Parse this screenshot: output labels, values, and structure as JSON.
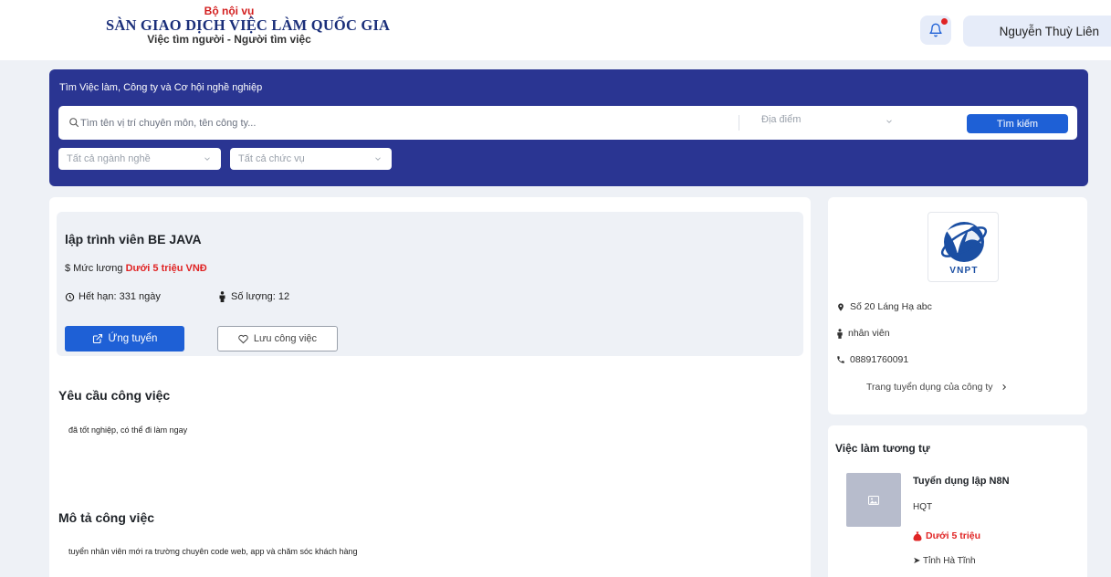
{
  "header": {
    "ministry": "Bộ nội vụ",
    "site_name": "SÀN GIAO DỊCH VIỆC LÀM QUỐC GIA",
    "slogan": "Việc tìm người - Người tìm việc",
    "user_name": "Nguyễn Thuỳ Liên",
    "icons": [
      "bell-icon"
    ]
  },
  "search": {
    "heading": "Tìm Việc làm, Công ty và Cơ hội nghề nghiệp",
    "placeholder": "Tìm tên vị trí chuyên môn, tên công ty...",
    "location_placeholder": "Địa điểm",
    "button_label": "Tìm kiếm",
    "industry_filter": "Tất cả ngành nghề",
    "position_filter": "Tất cả chức vụ"
  },
  "job": {
    "title": "lập trình viên BE JAVA",
    "salary_label": "$ Mức lương",
    "salary_value": "Dưới 5 triệu VNĐ",
    "deadline": "Hết hạn: 331 ngày",
    "quantity": "Số lượng: 12",
    "apply_label": "Ứng tuyển",
    "save_label": "Lưu công việc",
    "requirements_heading": "Yêu cầu công việc",
    "requirements_text": "đã tốt nghiệp, có thể đi làm ngay",
    "description_heading": "Mô tả công việc",
    "description_text": "tuyển nhân viên mới ra trường chuyên code web, app và chăm sóc khách hàng"
  },
  "company": {
    "logo_text": "VNPT",
    "address": "Số 20 Láng Hạ abc",
    "contact_role": "nhân viên",
    "phone": "08891760091",
    "link_label": "Trang tuyển dụng của công ty"
  },
  "similar": {
    "heading": "Việc làm tương tự",
    "items": [
      {
        "title": "Tuyển dụng lập N8N",
        "company": "HQT",
        "salary": "Dưới 5 triệu",
        "location": "Tỉnh Hà Tĩnh"
      }
    ]
  },
  "colors": {
    "primary": "#1e60d6",
    "band": "#2a3592",
    "accent_red": "#e02424",
    "background": "#eef1f6"
  }
}
